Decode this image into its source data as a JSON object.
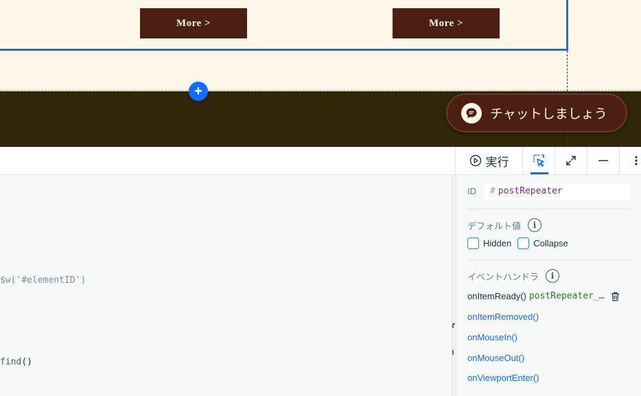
{
  "site": {
    "more_button_1": "More >",
    "more_button_2": "More >",
    "add_section": "+",
    "chat_label": "チャットしましょう"
  },
  "toolbar": {
    "run_label": "実行"
  },
  "code": {
    "line_1": "$w('#elementID')",
    "line_2_fn": "find",
    "line_2_paren": "()"
  },
  "panel": {
    "id_label": "ID",
    "id_hash": "#",
    "id_value": "postRepeater",
    "default_title": "デフォルト値",
    "hidden_label": "Hidden",
    "collapse_label": "Collapse",
    "events_title": "イベントハンドラ",
    "events": {
      "ready_label": "onItemReady()",
      "ready_handler": "postRepeater_…",
      "removed": "onItemRemoved()",
      "mousein": "onMouseIn()",
      "mouseout": "onMouseOut()",
      "viewport_enter": "onViewportEnter()"
    }
  },
  "colors": {
    "accent": "#116dff",
    "brand_brown": "#4b1f12",
    "cream": "#fdf7ea",
    "footer_dark": "#2f2508"
  }
}
